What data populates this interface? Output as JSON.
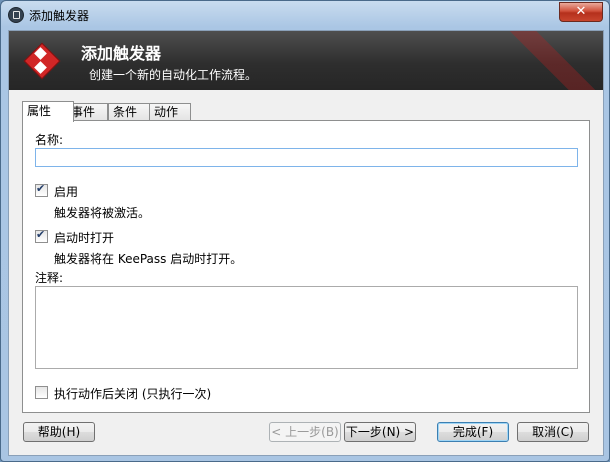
{
  "window": {
    "title": "添加触发器",
    "close_label": "✕",
    "app_icon": "lock-icon"
  },
  "banner": {
    "title": "添加触发器",
    "subtitle": "创建一个新的自动化工作流程。",
    "icon": "keepass-logo-icon"
  },
  "tabs": [
    {
      "label": "属性",
      "active": true
    },
    {
      "label": "事件",
      "active": false
    },
    {
      "label": "条件",
      "active": false
    },
    {
      "label": "动作",
      "active": false
    }
  ],
  "properties": {
    "name_label": "名称:",
    "name_value": "",
    "enabled": {
      "label": "启用",
      "checked": true,
      "description": "触发器将被激活。"
    },
    "initially_on": {
      "label": "启动时打开",
      "checked": true,
      "description": "触发器将在 KeePass 启动时打开。"
    },
    "comments_label": "注释:",
    "comments_value": "",
    "turn_off_after": {
      "label": "执行动作后关闭 (只执行一次)",
      "checked": false
    }
  },
  "buttons": {
    "help": "帮助(H)",
    "back": "< 上一步(B)",
    "next": "下一步(N) >",
    "finish": "完成(F)",
    "cancel": "取消(C)"
  }
}
